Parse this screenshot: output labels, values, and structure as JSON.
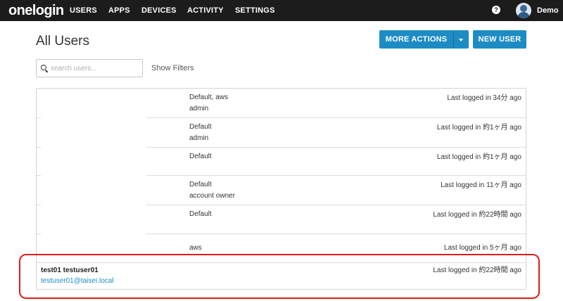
{
  "app": {
    "logo": "onelogin",
    "user_name": "Demo",
    "help_label": "?"
  },
  "nav": {
    "items": [
      {
        "label": "USERS"
      },
      {
        "label": "APPS"
      },
      {
        "label": "DEVICES"
      },
      {
        "label": "ACTIVITY"
      },
      {
        "label": "SETTINGS"
      }
    ]
  },
  "page": {
    "title": "All Users"
  },
  "actions": {
    "more_actions": "MORE ACTIONS",
    "new_user": "NEW USER"
  },
  "search": {
    "placeholder": "search users...",
    "value": "",
    "show_filters": "Show Filters"
  },
  "users": [
    {
      "name": "",
      "email": "",
      "role_line1": "Default, aws",
      "role_line2": "admin",
      "last_login": "Last logged in 34分 ago"
    },
    {
      "name": "",
      "email": "",
      "role_line1": "Default",
      "role_line2": "admin",
      "last_login": "Last logged in 約1ヶ月 ago"
    },
    {
      "name": "",
      "email": "",
      "role_line1": "Default",
      "role_line2": "",
      "last_login": "Last logged in 約1ヶ月 ago"
    },
    {
      "name": "",
      "email": "",
      "role_line1": "Default",
      "role_line2": "account owner",
      "last_login": "Last logged in 11ヶ月 ago"
    },
    {
      "name": "",
      "email": "",
      "role_line1": "Default",
      "role_line2": "",
      "last_login": "Last logged in 約22時間 ago"
    },
    {
      "name": "",
      "email": "",
      "role_line1": "aws",
      "role_line2": "",
      "last_login": "Last logged in 5ヶ月 ago"
    },
    {
      "name": "test01 testuser01",
      "email": "testuser01@taisei.local",
      "role_line1": "",
      "role_line2": "",
      "last_login": "Last logged in 約22時間 ago"
    }
  ],
  "colors": {
    "nav_bg": "#1c1c1c",
    "accent": "#1d8cc4",
    "highlight": "#e21a1a"
  },
  "icons": {
    "help": "help-icon",
    "search": "search-icon",
    "avatar": "avatar",
    "dropdown": "caret-down-icon"
  }
}
